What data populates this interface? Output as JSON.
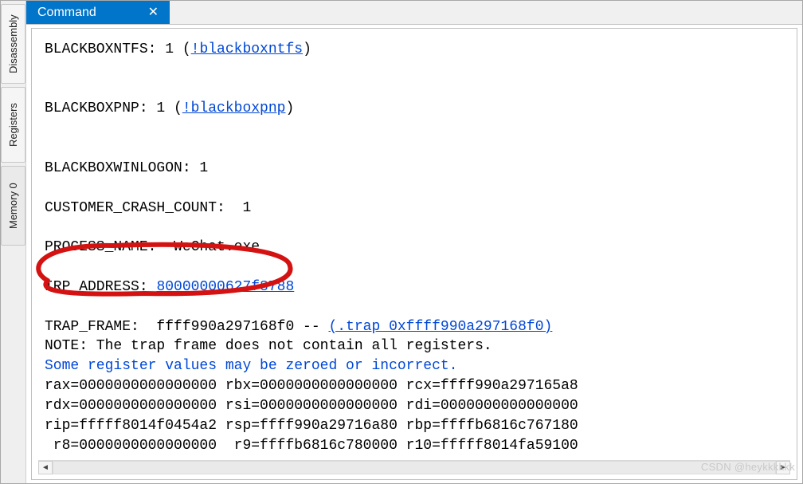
{
  "sidebar": {
    "tabs": [
      {
        "label": "Disassembly"
      },
      {
        "label": "Registers"
      },
      {
        "label": "Memory 0"
      }
    ]
  },
  "header": {
    "active_tab": "Command",
    "close_glyph": "✕"
  },
  "output": {
    "bbntfs_label": "BLACKBOXNTFS: 1 (",
    "bbntfs_link": "!blackboxntfs",
    "bbntfs_close": ")",
    "bbpnp_label": "BLACKBOXPNP: 1 (",
    "bbpnp_link": "!blackboxpnp",
    "bbpnp_close": ")",
    "bbwinlogon": "BLACKBOXWINLOGON: 1",
    "cust_crash": "CUSTOMER_CRASH_COUNT:  1",
    "process_name": "PROCESS_NAME:  WeChat.exe",
    "irp_label": "IRP_ADDRESS: ",
    "irp_link": "80000000627f8788",
    "trap_label": "TRAP_FRAME:  ffff990a297168f0 -- ",
    "trap_link": "(.trap 0xffff990a297168f0)",
    "note_line": "NOTE: The trap frame does not contain all registers.",
    "warn_line": "Some register values may be zeroed or incorrect.",
    "reg_rax": "rax=0000000000000000 rbx=0000000000000000 rcx=ffff990a297165a8",
    "reg_rdx": "rdx=0000000000000000 rsi=0000000000000000 rdi=0000000000000000",
    "reg_rip": "rip=fffff8014f0454a2 rsp=ffff990a29716a80 rbp=ffffb6816c767180",
    "reg_r8": " r8=0000000000000000  r9=ffffb6816c780000 r10=fffff8014fa59100"
  },
  "scrollbar": {
    "left_glyph": "◄",
    "right_glyph": "►"
  },
  "watermark": "CSDN @heykkkkkk"
}
